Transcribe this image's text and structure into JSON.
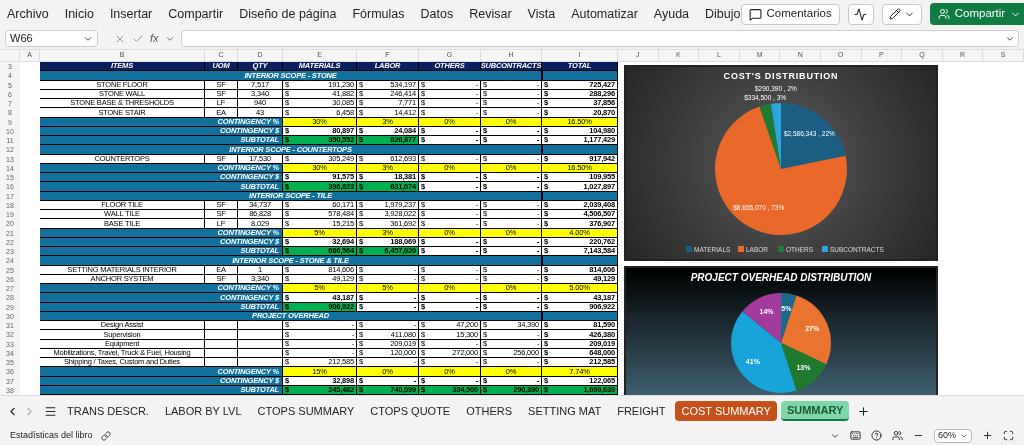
{
  "menu": {
    "items": [
      "Archivo",
      "Inicio",
      "Insertar",
      "Compartir",
      "Diseño de página",
      "Fórmulas",
      "Datos",
      "Revisar",
      "Vista",
      "Automatizar",
      "Ayuda",
      "Dibujo"
    ],
    "comments_button": "Comentarios",
    "share_button": "Compartir"
  },
  "formula_bar": {
    "name_box": "W66",
    "function_label": "fx"
  },
  "column_letters": [
    "A",
    "B",
    "C",
    "D",
    "E",
    "F",
    "G",
    "H",
    "I",
    "J",
    "K",
    "L",
    "M",
    "N",
    "O",
    "P",
    "Q",
    "R",
    "S"
  ],
  "table": {
    "rows": [
      {
        "n": "3",
        "kind": "header",
        "cells": [
          "ITEMS",
          "UOM",
          "QTY",
          "MATERIALS",
          "LABOR",
          "OTHERS",
          "SUBCONTRACTS",
          "TOTAL"
        ]
      },
      {
        "n": "4",
        "kind": "section",
        "label": "INTERIOR SCOPE - STONE"
      },
      {
        "n": "5",
        "kind": "item",
        "cells": [
          "STONE FLOOR",
          "SF",
          "7,517",
          "$ 191,230",
          "$ 534,197",
          "$ -",
          "$ -",
          "$ 725,427"
        ]
      },
      {
        "n": "6",
        "kind": "item",
        "cells": [
          "STONE WALL",
          "SF",
          "3,340",
          "$ 41,882",
          "$ 246,414",
          "$ -",
          "$ -",
          "$ 288,296"
        ]
      },
      {
        "n": "7",
        "kind": "item",
        "cells": [
          "STONE BASE & THRESHOLDS",
          "LF",
          "940",
          "$ 30,085",
          "$ 7,771",
          "$ -",
          "$ -",
          "$ 37,856"
        ]
      },
      {
        "n": "8",
        "kind": "item",
        "cells": [
          "STONE STAIR",
          "EA",
          "43",
          "$ 6,458",
          "$ 14,412",
          "$ -",
          "$ -",
          "$ 20,870"
        ]
      },
      {
        "n": "9",
        "kind": "pct",
        "label": "CONTINGENCY %",
        "cells": [
          "30%",
          "3%",
          "0%",
          "0%",
          "16.50%"
        ]
      },
      {
        "n": "10",
        "kind": "amount",
        "label": "CONTINGENCY $",
        "cells": [
          "$ 80,897",
          "$ 24,084",
          "$ -",
          "$ -",
          "$ 104,980"
        ]
      },
      {
        "n": "11",
        "kind": "subtotal",
        "label": "SUBTOTAL",
        "cells": [
          "$ 350,552",
          "$ 826,877",
          "$ -",
          "$ -",
          "$ 1,177,429"
        ],
        "highlighted": [
          true,
          true,
          false,
          false,
          false
        ]
      },
      {
        "n": "12",
        "kind": "section",
        "label": "INTERIOR SCOPE - COUNTERTOPS"
      },
      {
        "n": "13",
        "kind": "item",
        "cells": [
          "COUNTERTOPS",
          "SF",
          "17,530",
          "$ 305,249",
          "$ 612,693",
          "$ -",
          "$ -",
          "$ 917,942"
        ]
      },
      {
        "n": "14",
        "kind": "pct",
        "label": "CONTINGENCY %",
        "cells": [
          "30%",
          "3%",
          "0%",
          "0%",
          "16.50%"
        ]
      },
      {
        "n": "15",
        "kind": "amount",
        "label": "CONTINGENCY $",
        "cells": [
          "$ 91,575",
          "$ 18,381",
          "$ -",
          "$ -",
          "$ 109,955"
        ]
      },
      {
        "n": "16",
        "kind": "subtotal",
        "label": "SUBTOTAL",
        "cells": [
          "$ 396,823",
          "$ 631,074",
          "$ -",
          "$ -",
          "$ 1,027,897"
        ],
        "highlighted": [
          true,
          true,
          false,
          false,
          false
        ]
      },
      {
        "n": "17",
        "kind": "section",
        "label": "INTERIOR SCOPE - TILE"
      },
      {
        "n": "18",
        "kind": "item",
        "cells": [
          "FLOOR TILE",
          "SF",
          "34,737",
          "$ 60,171",
          "$ 1,979,237",
          "$ -",
          "$ -",
          "$ 2,039,408"
        ]
      },
      {
        "n": "19",
        "kind": "item",
        "cells": [
          "WALL TILE",
          "SF",
          "86,828",
          "$ 578,484",
          "$ 3,928,022",
          "$ -",
          "$ -",
          "$ 4,506,507"
        ]
      },
      {
        "n": "20",
        "kind": "item",
        "cells": [
          "BASE TILE",
          "LF",
          "8,029",
          "$ 15,215",
          "$ 361,692",
          "$ -",
          "$ -",
          "$ 376,907"
        ]
      },
      {
        "n": "21",
        "kind": "pct",
        "label": "CONTINGENCY %",
        "cells": [
          "5%",
          "3%",
          "0%",
          "0%",
          "4.00%"
        ]
      },
      {
        "n": "22",
        "kind": "amount",
        "label": "CONTINGENCY $",
        "cells": [
          "$ 32,694",
          "$ 188,069",
          "$ -",
          "$ -",
          "$ 220,762"
        ]
      },
      {
        "n": "23",
        "kind": "subtotal",
        "label": "SUBTOTAL",
        "cells": [
          "$ 686,564",
          "$ 6,457,020",
          "$ -",
          "$ -",
          "$ 7,143,584"
        ],
        "highlighted": [
          true,
          true,
          false,
          false,
          false
        ]
      },
      {
        "n": "24",
        "kind": "section",
        "label": "INTERIOR SCOPE - STONE & TILE"
      },
      {
        "n": "25",
        "kind": "item",
        "cells": [
          "SETTING MATERIALS INTERIOR",
          "EA",
          "1",
          "$ 814,606",
          "$ -",
          "$ -",
          "$ -",
          "$ 814,606"
        ]
      },
      {
        "n": "26",
        "kind": "item",
        "cells": [
          "ANCHOR SYSTEM",
          "SF",
          "3,340",
          "$ 49,129",
          "$ -",
          "$ -",
          "$ -",
          "$ 49,129"
        ]
      },
      {
        "n": "27",
        "kind": "pct",
        "label": "CONTINGENCY %",
        "cells": [
          "5%",
          "5%",
          "0%",
          "0%",
          "5.00%"
        ]
      },
      {
        "n": "28",
        "kind": "amount",
        "label": "CONTINGENCY $",
        "cells": [
          "$ 43,187",
          "$ -",
          "$ -",
          "$ -",
          "$ 43,187"
        ]
      },
      {
        "n": "29",
        "kind": "subtotal",
        "label": "SUBTOTAL",
        "cells": [
          "$ 906,922",
          "$ -",
          "$ -",
          "$ -",
          "$ 906,922"
        ],
        "highlighted": [
          true,
          false,
          false,
          false,
          false
        ]
      },
      {
        "n": "30",
        "kind": "section",
        "label": "PROJECT OVERHEAD"
      },
      {
        "n": "31",
        "kind": "item",
        "cells": [
          "Design Assist",
          null,
          null,
          "$ -",
          "$ -",
          "$ 47,200",
          "$ 34,390",
          "$ 81,590"
        ]
      },
      {
        "n": "32",
        "kind": "item",
        "cells": [
          "Supervision",
          null,
          null,
          "$ -",
          "$ 411,080",
          "$ 15,300",
          "$ -",
          "$ 426,380"
        ]
      },
      {
        "n": "33",
        "kind": "item",
        "cells": [
          "Equipment",
          null,
          null,
          "$ -",
          "$ 209,019",
          "$ -",
          "$ -",
          "$ 209,019"
        ]
      },
      {
        "n": "34",
        "kind": "item",
        "cells": [
          "Mobilizations, Travel, Truck & Fuel, Housing",
          null,
          null,
          "$ -",
          "$ 120,000",
          "$ 272,000",
          "$ 256,000",
          "$ 648,000"
        ]
      },
      {
        "n": "35",
        "kind": "item",
        "cells": [
          "Shipping / Taxes, Custom and Duties",
          null,
          null,
          "$ 212,585",
          "$ -",
          "$ -",
          "$ -",
          "$ 212,585"
        ]
      },
      {
        "n": "36",
        "kind": "pct",
        "label": "CONTINGENCY %",
        "cells": [
          "15%",
          "0%",
          "0%",
          "0%",
          "7.74%"
        ]
      },
      {
        "n": "37",
        "kind": "amount",
        "label": "CONTINGENCY $",
        "cells": [
          "$ 32,898",
          "$ -",
          "$ -",
          "$ -",
          "$ 122,065"
        ]
      },
      {
        "n": "38",
        "kind": "subtotal",
        "label": "SUBTOTAL",
        "cells": [
          "$ 245,482",
          "$ 740,099",
          "$ 334,500",
          "$ 290,390",
          "$ 1,699,639"
        ],
        "highlighted": [
          true,
          true,
          true,
          true,
          true
        ]
      }
    ]
  },
  "charts": [
    {
      "chart_data": {
        "type": "pie",
        "legend": "bottom",
        "title": "COST'S DISTRIBUTION",
        "categories": [
          "MATERIALS",
          "LABOR",
          "OTHERS",
          "SUBCONTRACTS"
        ],
        "values": [
          2586343,
          8655070,
          334500,
          290390
        ],
        "colors": [
          "#1b5e82",
          "#e8692a",
          "#1e7b34",
          "#2aa6dc"
        ],
        "value_labels": [
          "$2,586,343 , 22%",
          "$8,655,070 , 73%",
          "$334,500 , 3%",
          "$290,390 , 2%"
        ]
      }
    },
    {
      "chart_data": {
        "type": "pie",
        "title": "PROJECT OVERHEAD DISTRIBUTION",
        "values": [
          5,
          27,
          13,
          41,
          14
        ],
        "colors": [
          "#1b6a8c",
          "#e8742f",
          "#1f7a2f",
          "#18a4d8",
          "#a23b9b"
        ],
        "value_labels": [
          "5%",
          "27%",
          "13%",
          "41%",
          "14%"
        ]
      }
    }
  ],
  "sheet_tabs": {
    "tabs": [
      {
        "label": "TRANS DESCR.",
        "selected": false
      },
      {
        "label": "LABOR BY LVL",
        "selected": false
      },
      {
        "label": "CTOPS SUMMARY",
        "selected": false
      },
      {
        "label": "CTOPS QUOTE",
        "selected": false
      },
      {
        "label": "OTHERS",
        "selected": false
      },
      {
        "label": "SETTING MAT",
        "selected": false
      },
      {
        "label": "FREIGHT",
        "selected": false
      },
      {
        "label": "COST SUMMARY",
        "selected": false,
        "color": "#c5501a"
      },
      {
        "label": "SUMMARY",
        "selected": true,
        "color": "#7fd6a8"
      }
    ]
  },
  "status_bar": {
    "text": "Estadísticas del libro",
    "zoom": "60%"
  }
}
